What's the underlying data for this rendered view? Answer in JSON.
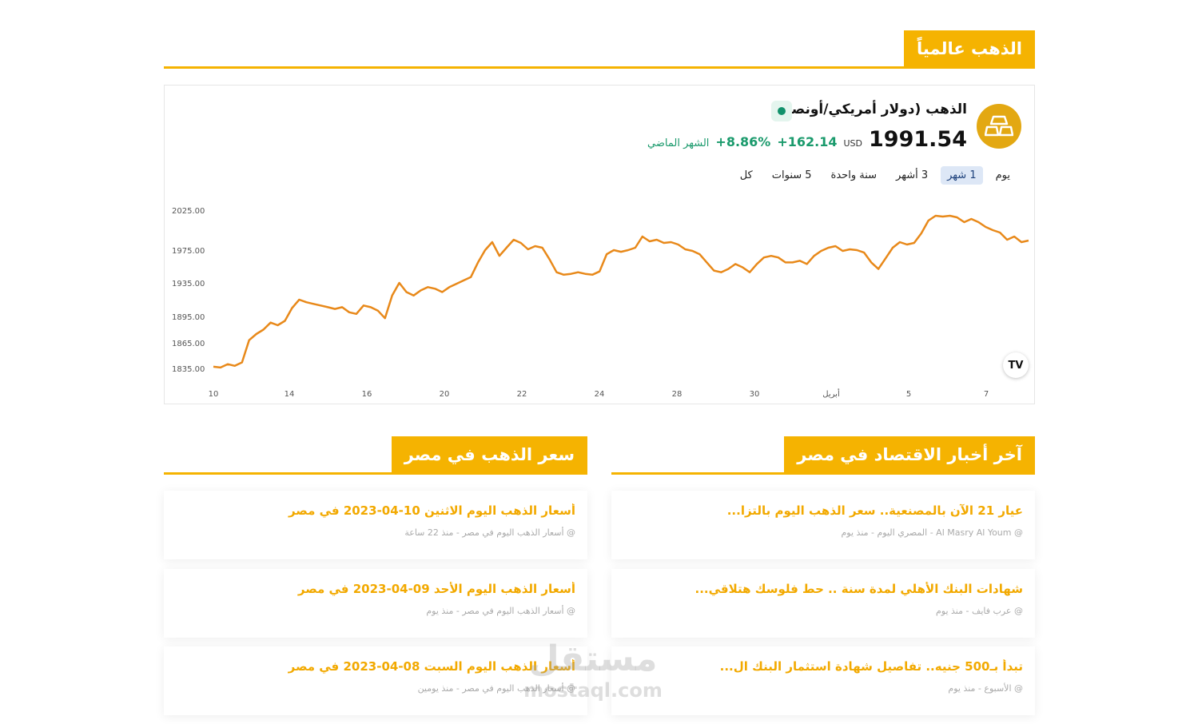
{
  "sections": {
    "global": "الذهب عالمياً",
    "price_egypt": "سعر الذهب في مصر",
    "news_egypt": "آخر أخبار الاقتصاد في مصر"
  },
  "widget": {
    "title": "الذهب (دولار أمريكي/أونصة)",
    "price": "1991.54",
    "currency": "USD",
    "change": "+162.14",
    "change_pct": "+8.86%",
    "period": "الشهر الماضي",
    "ranges": [
      "يوم",
      "1 شهر",
      "3 أشهر",
      "سنة واحدة",
      "5 سنوات",
      "كل"
    ],
    "active_range": "1 شهر",
    "logo": "TV"
  },
  "chart_data": {
    "type": "line",
    "y_ticks": [
      "2025.00",
      "1975.00",
      "1935.00",
      "1895.00",
      "1865.00",
      "1835.00"
    ],
    "x_ticks": [
      "10",
      "14",
      "16",
      "20",
      "22",
      "24",
      "28",
      "30",
      "أبريل",
      "5",
      "7"
    ],
    "color": "#e8891a",
    "grid": false,
    "series": [
      {
        "values": [
          1837,
          1836,
          1840,
          1838,
          1842,
          1868,
          1875,
          1880,
          1888,
          1885,
          1890,
          1905,
          1915,
          1912,
          1910,
          1908,
          1906,
          1904,
          1906,
          1900,
          1898,
          1908,
          1906,
          1902,
          1893,
          1920,
          1935,
          1924,
          1920,
          1926,
          1930,
          1928,
          1924,
          1930,
          1934,
          1938,
          1942,
          1960,
          1975,
          1985,
          1968,
          1978,
          1988,
          1984,
          1976,
          1980,
          1978,
          1964,
          1948,
          1945,
          1946,
          1948,
          1946,
          1945,
          1949,
          1970,
          1975,
          1973,
          1975,
          1978,
          1992,
          1986,
          1988,
          1984,
          1985,
          1982,
          1976,
          1974,
          1970,
          1960,
          1950,
          1948,
          1952,
          1958,
          1954,
          1948,
          1958,
          1966,
          1968,
          1966,
          1960,
          1960,
          1962,
          1958,
          1968,
          1974,
          1978,
          1980,
          1974,
          1976,
          1975,
          1972,
          1960,
          1952,
          1965,
          1978,
          1985,
          1982,
          1984,
          1996,
          2012,
          2018,
          2017,
          2018,
          2016,
          2010,
          2014,
          2010,
          2004,
          2000,
          1997,
          1988,
          1992,
          1985,
          1987
        ]
      }
    ]
  },
  "price_cards": [
    {
      "title": "أسعار الذهب اليوم الاثنين 10-04-2023 في مصر",
      "meta": "@ أسعار الذهب اليوم في مصر - منذ 22 ساعة"
    },
    {
      "title": "أسعار الذهب اليوم الأحد 09-04-2023 في مصر",
      "meta": "@ أسعار الذهب اليوم في مصر - منذ يوم"
    },
    {
      "title": "أسعار الذهب اليوم السبت 08-04-2023 في مصر",
      "meta": "@ أسعار الذهب اليوم في مصر - منذ يومين"
    }
  ],
  "news_cards": [
    {
      "title": "عيار 21 الآن بالمصنعية.. سعر الذهب اليوم بالتزا...",
      "meta": "@ Al Masry Al Youm - المصري اليوم - منذ يوم"
    },
    {
      "title": "شهادات البنك الأهلي لمدة سنة .. حط فلوسك هتلاقي...",
      "meta": "@ عرب فايف - منذ يوم"
    },
    {
      "title": "تبدأ بـ500 جنيه.. تفاصيل شهادة استثمار البنك ال...",
      "meta": "@ الأسبوع - منذ يوم"
    }
  ],
  "watermark": {
    "line1": "مستقل",
    "line2": "mostaql.com"
  }
}
